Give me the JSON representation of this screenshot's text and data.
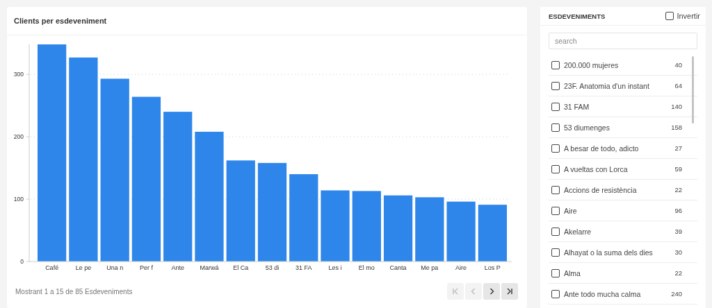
{
  "chart_card": {
    "title": "Clients per esdeveniment",
    "chart_data": {
      "type": "bar",
      "categories": [
        "Café",
        "Le pe",
        "Una n",
        "Per f",
        "Ante",
        "Marwá",
        "El Ca",
        "53 di",
        "31 FA",
        "Les i",
        "El mo",
        "Canta",
        "Me pa",
        "Aire",
        "Los P"
      ],
      "series": [
        {
          "color": "#2e86ea",
          "values": [
            348,
            327,
            293,
            264,
            240,
            208,
            162,
            158,
            140,
            114,
            113,
            106,
            103,
            96,
            91
          ]
        }
      ],
      "ylim": [
        0,
        348
      ],
      "yticks": [
        0,
        100,
        200,
        300
      ],
      "grid": true
    },
    "footer": "Mostrant 1 a 15 de 85 Esdeveniments",
    "pagination": [
      {
        "kind": "first",
        "disabled": true
      },
      {
        "kind": "prev",
        "disabled": true
      },
      {
        "kind": "next",
        "disabled": false
      },
      {
        "kind": "last",
        "disabled": false
      }
    ]
  },
  "filter_panel": {
    "title": "ESDEVENIMENTS",
    "invert": {
      "label": "Invertir",
      "checked": false
    },
    "search": {
      "placeholder": "search"
    },
    "items": [
      {
        "label": "200.000 mujeres",
        "count": "40",
        "checked": false
      },
      {
        "label": "23F. Anatomia d'un instant",
        "count": "64",
        "checked": false
      },
      {
        "label": "31 FAM",
        "count": "140",
        "checked": false
      },
      {
        "label": "53 diumenges",
        "count": "158",
        "checked": false
      },
      {
        "label": "A besar de todo, adicto",
        "count": "27",
        "checked": false
      },
      {
        "label": "A vueltas con Lorca",
        "count": "59",
        "checked": false
      },
      {
        "label": "Accions de resistència",
        "count": "22",
        "checked": false
      },
      {
        "label": "Aire",
        "count": "96",
        "checked": false
      },
      {
        "label": "Akelarre",
        "count": "39",
        "checked": false
      },
      {
        "label": "Alhayat o la suma dels dies",
        "count": "30",
        "checked": false
      },
      {
        "label": "Alma",
        "count": "22",
        "checked": false
      },
      {
        "label": "Ante todo mucha calma",
        "count": "240",
        "checked": false
      }
    ]
  }
}
